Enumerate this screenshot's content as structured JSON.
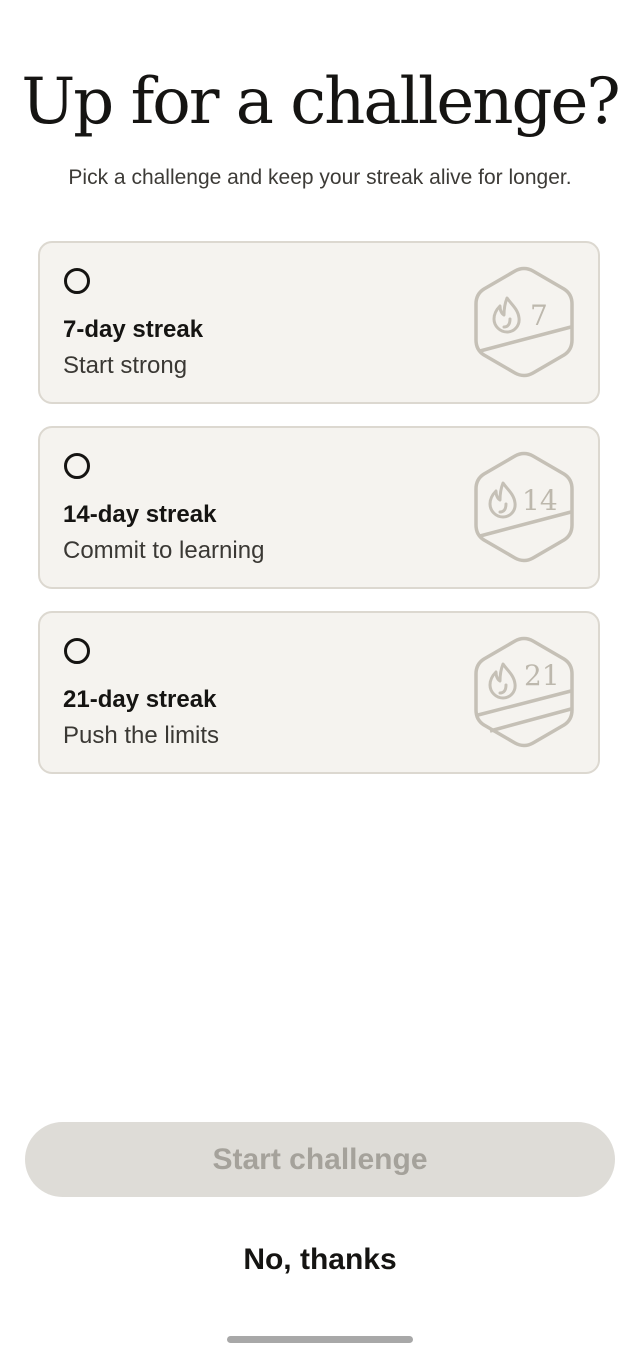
{
  "header": {
    "title": "Up for a challenge?",
    "subtitle": "Pick a challenge and keep your streak alive for longer."
  },
  "challenges": [
    {
      "title": "7-day streak",
      "subtitle": "Start strong",
      "badge_number": "7",
      "badge_stripes": 1,
      "selected": false
    },
    {
      "title": "14-day streak",
      "subtitle": "Commit to learning",
      "badge_number": "14",
      "badge_stripes": 1,
      "selected": false
    },
    {
      "title": "21-day streak",
      "subtitle": "Push the limits",
      "badge_number": "21",
      "badge_stripes": 2,
      "selected": false
    }
  ],
  "actions": {
    "start_label": "Start challenge",
    "dismiss_label": "No, thanks"
  },
  "icons": {
    "radio": "radio-unselected-icon",
    "badge": "hexagon-flame-badge-icon"
  },
  "colors": {
    "card_background": "#f5f3ef",
    "card_border": "#dcd8d0",
    "badge_stroke": "#c5c0b6",
    "disabled_button": "#dedcd7",
    "disabled_text": "#a5a29b",
    "text_primary": "#151412"
  }
}
